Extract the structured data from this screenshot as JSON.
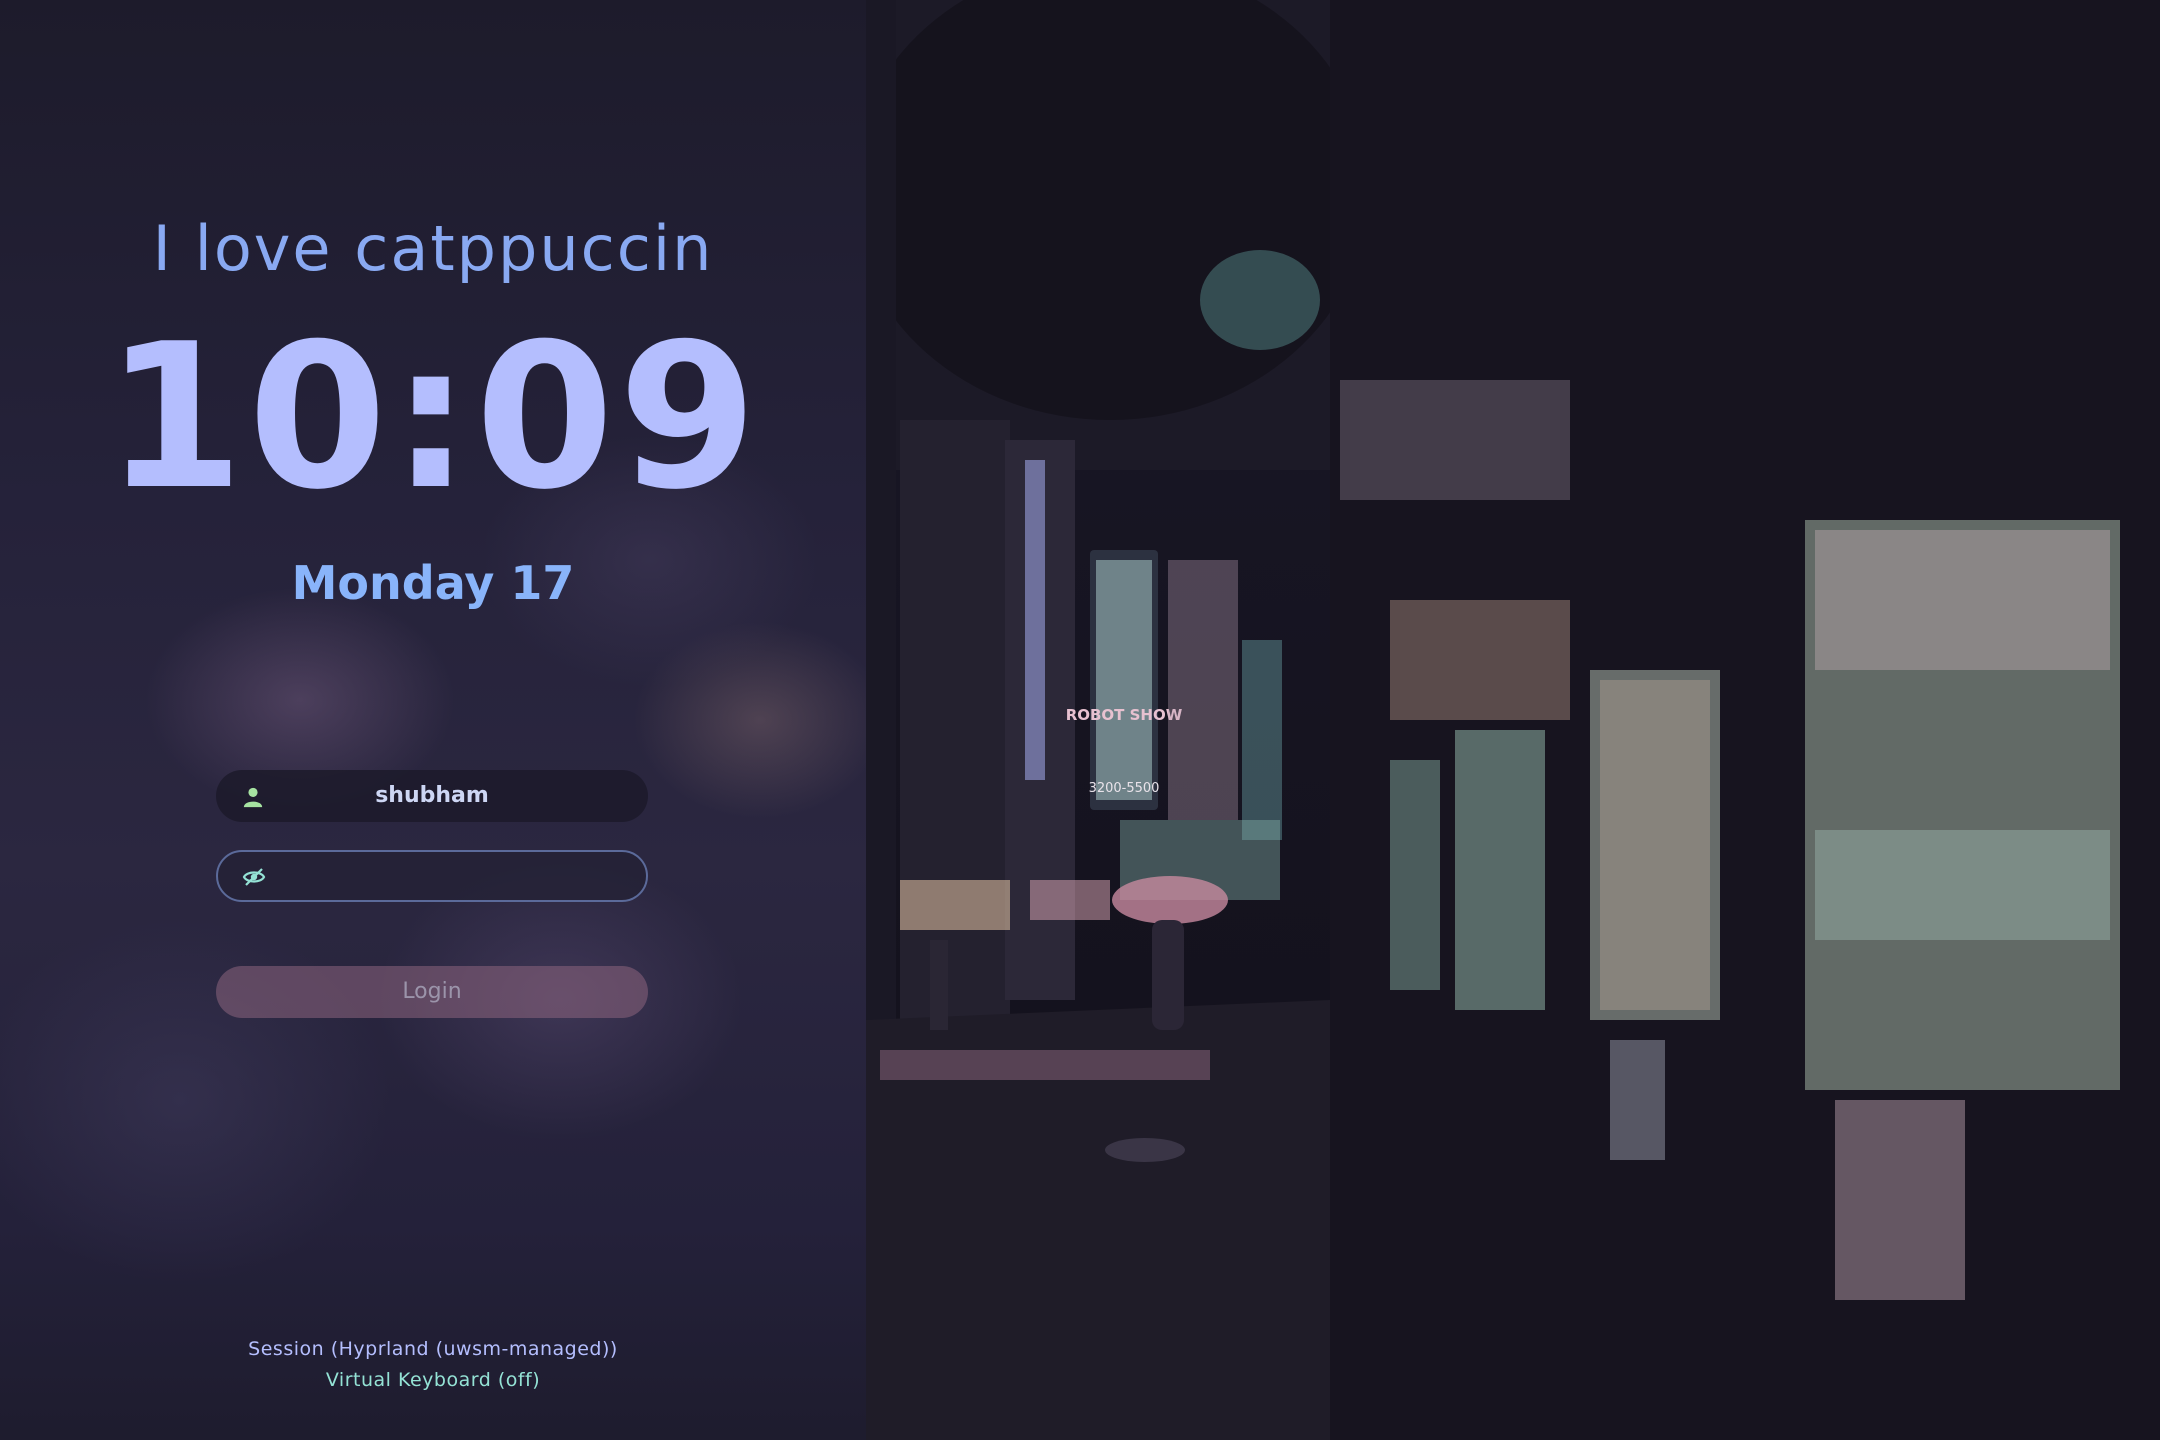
{
  "greeting": "I love catppuccin",
  "clock": "10:09",
  "date": "Monday 17",
  "user": {
    "icon": "user-icon",
    "username": "shubham"
  },
  "password": {
    "icon": "eye-off-icon",
    "value": ""
  },
  "login_label": "Login",
  "footer": {
    "session": "Session (Hyprland (uwsm-managed))",
    "virtual_keyboard": "Virtual Keyboard (off)"
  },
  "wallpaper_signs": {
    "robot_show": "ROBOT SHOW",
    "phone": "3200-5500"
  },
  "colors": {
    "greeting": "#89a9f2",
    "clock": "#b4befe",
    "date": "#89b4fa",
    "user_icon": "#a6e3a1",
    "password_icon": "#94e2d5",
    "session": "#b4befe",
    "virtual_keyboard": "#94e2d5"
  }
}
